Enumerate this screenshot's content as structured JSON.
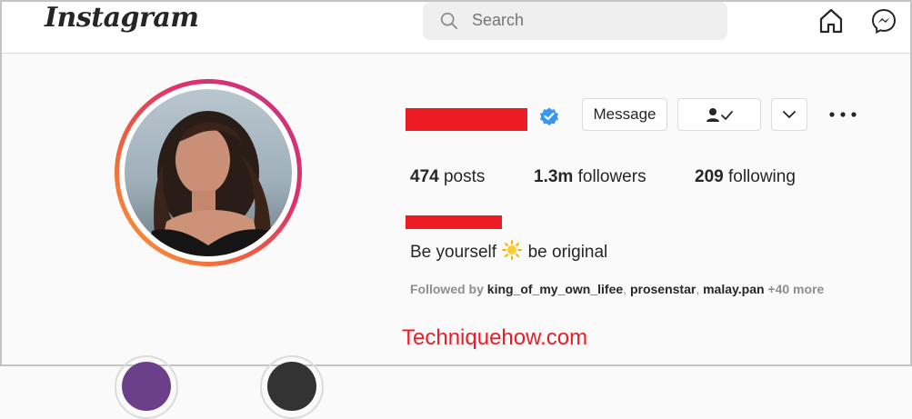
{
  "header": {
    "logo_text": "Instagram",
    "search": {
      "placeholder": "Search",
      "icon": "search-icon"
    },
    "nav_icons": [
      "home-icon",
      "messenger-icon"
    ]
  },
  "profile": {
    "verified": true,
    "actions": {
      "message_label": "Message",
      "following_icon": "person-check-icon",
      "dropdown_icon": "chevron-down-icon",
      "more_icon": "more-options-icon"
    },
    "stats": {
      "posts_count": "474",
      "posts_label": "posts",
      "followers_count": "1.3m",
      "followers_label": "followers",
      "following_count": "209",
      "following_label": "following"
    },
    "bio": {
      "part1": "Be yourself",
      "emoji": "sun-emoji",
      "part2": "be original"
    },
    "followed_by": {
      "label": "Followed by",
      "names": [
        "king_of_my_own_lifee",
        "prosenstar",
        "malay.pan"
      ],
      "separator": ", ",
      "more": "+40 more"
    }
  },
  "watermark": "Techniquehow.com",
  "colors": {
    "accent_blue": "#0095f6",
    "verified_blue": "#3897f0",
    "redaction": "#ec1c24",
    "ring_gradient": [
      "#f9a13a",
      "#e1306c",
      "#c13584"
    ]
  }
}
